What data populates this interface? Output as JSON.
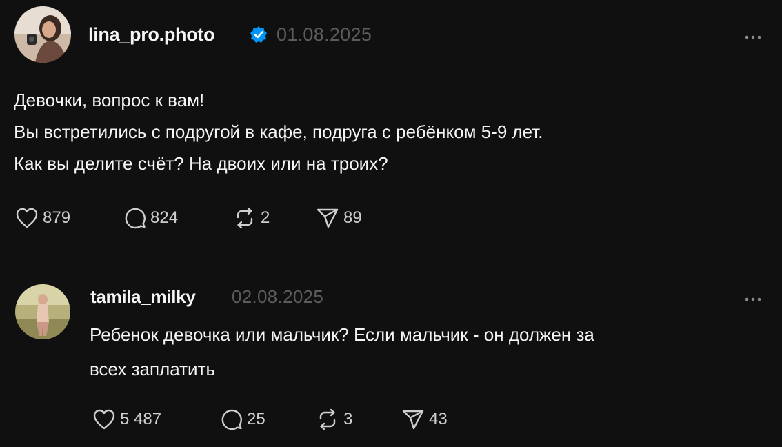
{
  "post": {
    "username": "lina_pro.photo",
    "date": "01.08.2025",
    "verified": true,
    "lines": [
      "Девочки, вопрос к вам!",
      "Вы встретились с подругой в кафе, подруга с ребёнком 5-9 лет.",
      "Как вы делите счёт? На двоих или на троих?"
    ],
    "likes": "879",
    "comments": "824",
    "reposts": "2",
    "shares": "89"
  },
  "reply": {
    "username": "tamila_milky",
    "date": "02.08.2025",
    "lines": [
      "Ребенок девочка или мальчик? Если мальчик - он должен за",
      "всех заплатить"
    ],
    "likes": "5 487",
    "comments": "25",
    "reposts": "3",
    "shares": "43"
  },
  "icons": {
    "like": "heart-icon",
    "comment": "comment-bubble-icon",
    "repost": "repost-icon",
    "share": "send-icon",
    "more": "more-horizontal-icon",
    "verified": "verified-badge-icon"
  },
  "colors": {
    "background": "#101010",
    "text": "#f3f5f7",
    "muted": "#5c5c5c",
    "verified": "#0095f6"
  }
}
